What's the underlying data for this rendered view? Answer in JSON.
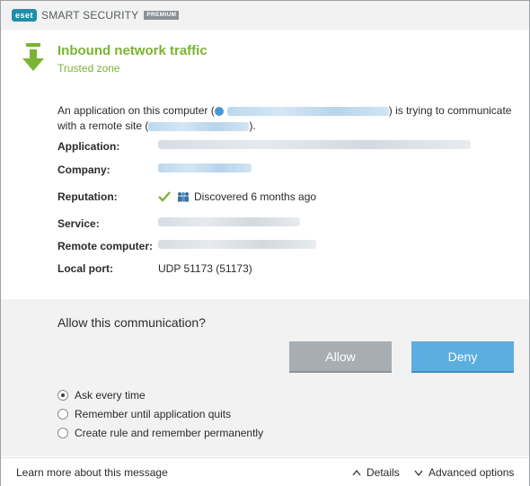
{
  "app": {
    "logo_text": "eset",
    "product_name": "SMART SECURITY",
    "edition": "PREMIUM"
  },
  "alert": {
    "title": "Inbound network traffic",
    "subtitle": "Trusted zone",
    "icon": "down-arrow-icon",
    "message_part1": "An application on this computer (",
    "message_part2": ") is trying to communicate with a remote site (",
    "message_part3": ")."
  },
  "details": {
    "application": {
      "label": "Application:"
    },
    "company": {
      "label": "Company:"
    },
    "reputation": {
      "label": "Reputation:",
      "value": "Discovered 6 months ago",
      "icons": [
        "check-icon",
        "users-icon"
      ]
    },
    "service": {
      "label": "Service:"
    },
    "remote_computer": {
      "label": "Remote computer:"
    },
    "local_port": {
      "label": "Local port:",
      "value": "UDP 51173 (51173)"
    }
  },
  "prompt": {
    "question": "Allow this communication?",
    "allow_label": "Allow",
    "deny_label": "Deny"
  },
  "options": [
    {
      "label": "Ask every time",
      "checked": true
    },
    {
      "label": "Remember until application quits",
      "checked": false
    },
    {
      "label": "Create rule and remember permanently",
      "checked": false
    }
  ],
  "footer": {
    "learn_more": "Learn more about this message",
    "details": "Details",
    "advanced_options": "Advanced options"
  },
  "colors": {
    "accent_green": "#7ab432",
    "deny_blue": "#5aaee0",
    "allow_gray": "#a8adb1",
    "link_blue": "#4a97d4"
  }
}
